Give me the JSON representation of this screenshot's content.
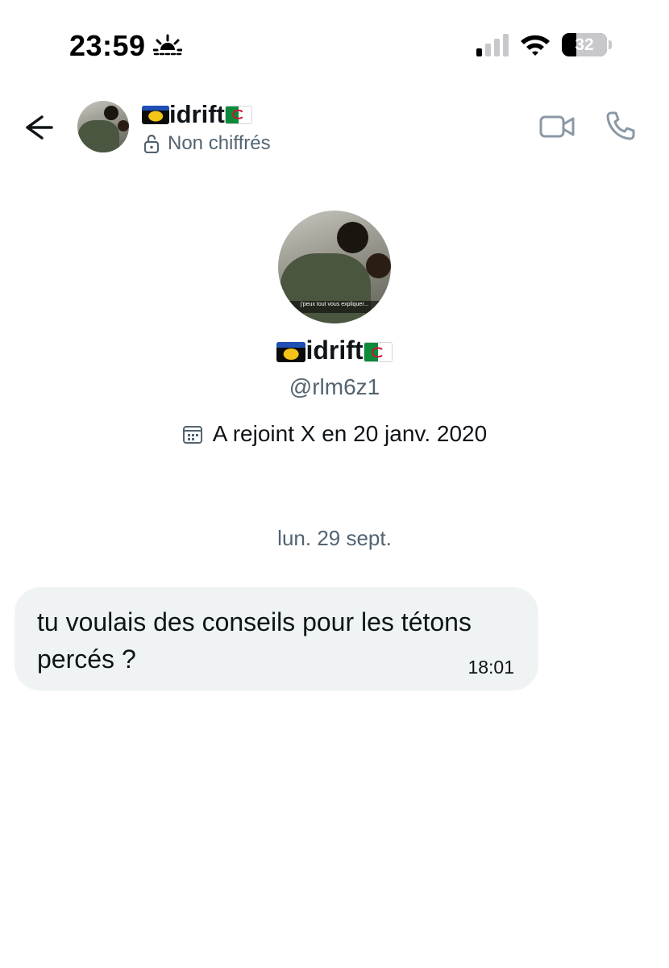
{
  "status_bar": {
    "time": "23:59",
    "battery_level": "32",
    "battery_fraction": 0.32,
    "icons": [
      "sunset-icon",
      "cellular-signal-icon",
      "wifi-icon",
      "battery-icon"
    ]
  },
  "header": {
    "back_icon": "arrow-left-icon",
    "name": "idrift",
    "encryption_status": "Non chiffrés",
    "video_call_icon": "video-camera-icon",
    "phone_call_icon": "phone-icon"
  },
  "profile": {
    "name": "idrift",
    "handle": "@rlm6z1",
    "joined": "A rejoint X en 20 janv. 2020",
    "avatar_caption": "j'peux tout vous expliquer..."
  },
  "conversation": {
    "date_separator": "lun. 29 sept.",
    "messages": [
      {
        "text": "tu voulais des conseils pour les tétons percés ?",
        "time": "18:01"
      }
    ]
  },
  "colors": {
    "background": "#ffffff",
    "primary_text": "#0f1419",
    "secondary_text": "#536471",
    "bubble": "#eff3f4"
  }
}
